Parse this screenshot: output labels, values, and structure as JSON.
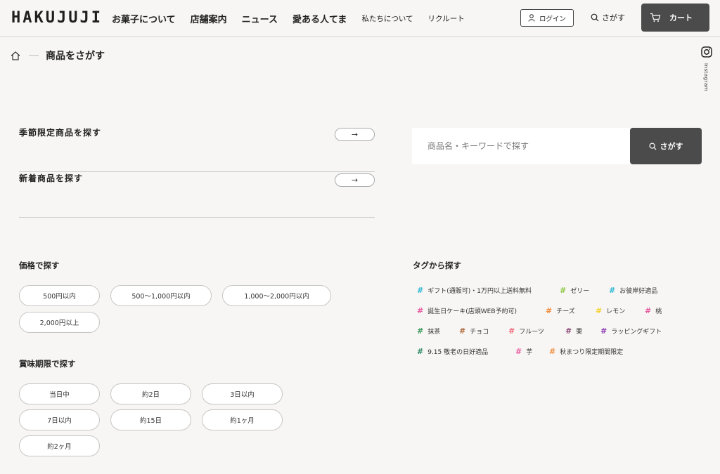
{
  "header": {
    "logo": "HAKUJUJI",
    "nav": [
      {
        "label": "お菓子について",
        "small": false
      },
      {
        "label": "店舗案内",
        "small": false
      },
      {
        "label": "ニュース",
        "small": false
      },
      {
        "label": "愛ある人てま",
        "small": false
      },
      {
        "label": "私たちについて",
        "small": true
      },
      {
        "label": "リクルート",
        "small": true
      }
    ],
    "login_label": "ログイン",
    "search_label": "さがす",
    "cart_label": "カート"
  },
  "side": {
    "instagram_label": "Instagram"
  },
  "breadcrumb": {
    "title": "商品をさがす"
  },
  "links": [
    {
      "label": "季節限定商品を探す",
      "arrow": "→"
    },
    {
      "label": "新着商品を探す",
      "arrow": "→"
    }
  ],
  "search": {
    "placeholder": "商品名・キーワードで探す",
    "button_label": "さがす"
  },
  "price": {
    "heading": "価格で探す",
    "options": [
      "500円以内",
      "500〜1,000円以内",
      "1,000〜2,000円以内",
      "2,000円以上"
    ]
  },
  "expiry": {
    "heading": "賞味期限で探す",
    "options": [
      "当日中",
      "約2日",
      "3日以内",
      "7日以内",
      "約15日",
      "約1ヶ月",
      "約2ヶ月"
    ]
  },
  "tags": {
    "heading": "タグから探す",
    "items": [
      {
        "label": "ギフト(通販可)・1万円以上送料無料",
        "color": "#29b6d1"
      },
      {
        "label": "ゼリー",
        "color": "#8cc63f"
      },
      {
        "label": "お彼岸好適品",
        "color": "#29b6d1"
      },
      {
        "label": "誕生日ケーキ(店頭WEB予約可)",
        "color": "#e95aa0"
      },
      {
        "label": "チーズ",
        "color": "#f08c3c"
      },
      {
        "label": "レモン",
        "color": "#f5d232"
      },
      {
        "label": "桃",
        "color": "#e95aa0"
      },
      {
        "label": "抹茶",
        "color": "#3a9a5c"
      },
      {
        "label": "チョコ",
        "color": "#b06a3c"
      },
      {
        "label": "フルーツ",
        "color": "#ef6a7a"
      },
      {
        "label": "栗",
        "color": "#8b4a7a"
      },
      {
        "label": "ラッピングギフト",
        "color": "#8e3ab5"
      },
      {
        "label": "9.15 敬老の日好適品",
        "color": "#2a8a62"
      },
      {
        "label": "芋",
        "color": "#e95aa0"
      },
      {
        "label": "秋まつり限定期間限定",
        "color": "#f08c3c"
      }
    ]
  }
}
